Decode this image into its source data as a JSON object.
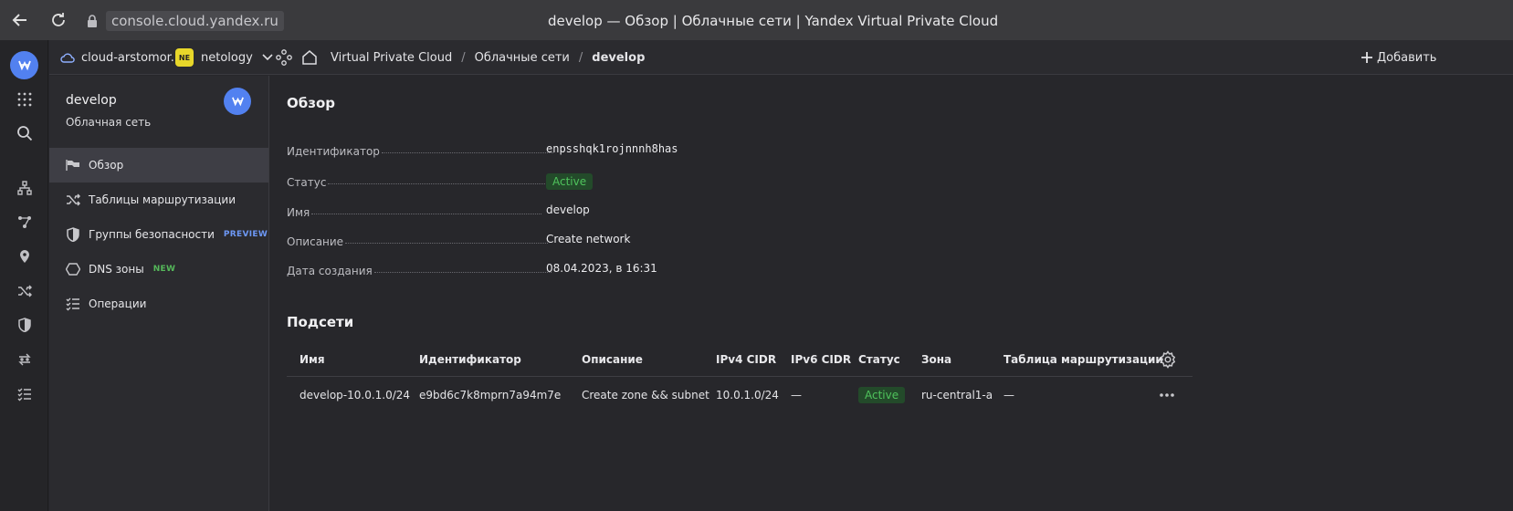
{
  "browser": {
    "url": "console.cloud.yandex.ru",
    "window_title": "develop — Обзор | Облачные сети | Yandex Virtual Private Cloud"
  },
  "header": {
    "cloud": "cloud-arstomor...",
    "folder_badge": "NE",
    "folder": "netology",
    "breadcrumbs": [
      "Virtual Private Cloud",
      "Облачные сети",
      "develop"
    ],
    "add_label": "Добавить"
  },
  "sidebar": {
    "title": "develop",
    "subtitle": "Облачная сеть",
    "items": [
      {
        "label": "Обзор",
        "icon": "flag-icon"
      },
      {
        "label": "Таблицы маршрутизации",
        "icon": "shuffle-icon"
      },
      {
        "label": "Группы безопасности",
        "icon": "shield-icon",
        "tag": "PREVIEW"
      },
      {
        "label": "DNS зоны",
        "icon": "hexagon-icon",
        "tag": "NEW"
      },
      {
        "label": "Операции",
        "icon": "list-check-icon"
      }
    ]
  },
  "overview": {
    "heading": "Обзор",
    "fields": [
      {
        "key": "Идентификатор",
        "value": "enpsshqk1rojnnnh8has"
      },
      {
        "key": "Статус",
        "value": "Active"
      },
      {
        "key": "Имя",
        "value": "develop"
      },
      {
        "key": "Описание",
        "value": "Create network"
      },
      {
        "key": "Дата создания",
        "value": "08.04.2023, в 16:31"
      }
    ]
  },
  "subnets": {
    "heading": "Подсети",
    "columns": [
      "Имя",
      "Идентификатор",
      "Описание",
      "IPv4 CIDR",
      "IPv6 CIDR",
      "Статус",
      "Зона",
      "Таблица маршрутизации"
    ],
    "rows": [
      [
        "develop-10.0.1.0/24",
        "e9bd6c7k8mprn7a94m7e",
        "Create zone && subnet",
        "10.0.1.0/24",
        "—",
        "Active",
        "ru-central1-a",
        "—"
      ]
    ]
  },
  "colors": {
    "accent": "#5281f0",
    "active_bg": "#234a2a",
    "active_text": "#4fc35c"
  }
}
